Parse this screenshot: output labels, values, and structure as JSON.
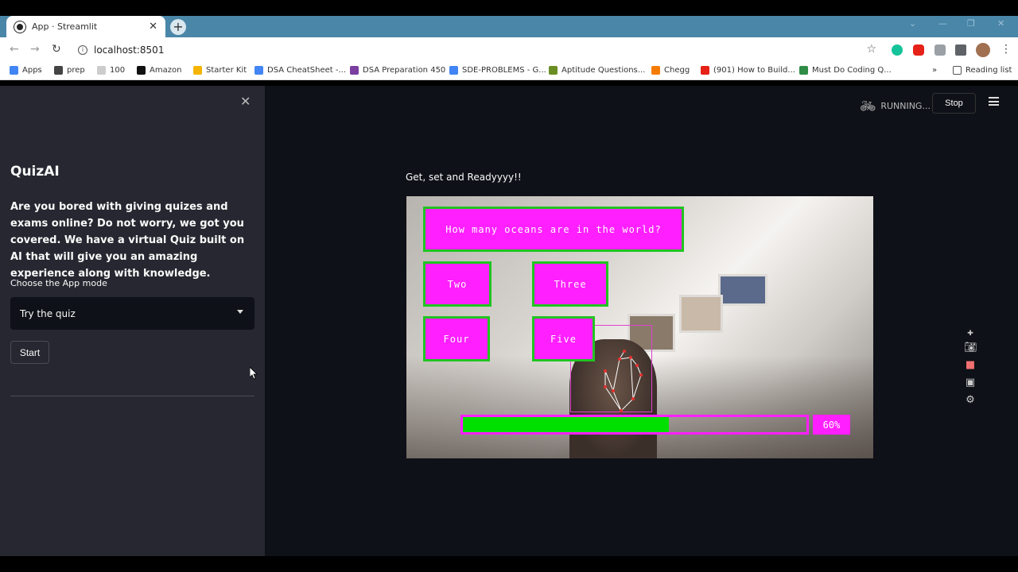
{
  "browser": {
    "tab_title": "App · Streamlit",
    "url": "localhost:8501",
    "bookmarks": [
      "Apps",
      "prep",
      "100",
      "Amazon",
      "Starter Kit",
      "DSA CheatSheet -...",
      "DSA Preparation 450",
      "SDE-PROBLEMS - G...",
      "Aptitude Questions...",
      "Chegg",
      "(901) How to Build...",
      "Must Do Coding Q..."
    ],
    "reading_list": "Reading list",
    "more": "»"
  },
  "sidebar": {
    "title": "QuizAI",
    "description": "Are you bored with giving quizes and exams online? Do not worry, we got you covered. We have a virtual Quiz built on AI that will give you an amazing experience along with knowledge.",
    "mode_label": "Choose the App mode",
    "mode_selected": "Try the quiz",
    "start_label": "Start"
  },
  "header": {
    "status": "RUNNING...",
    "stop_label": "Stop"
  },
  "main": {
    "caption": "Get, set and Readyyyy!!",
    "quiz": {
      "question": "How many oceans are in the world?",
      "options": [
        "Two",
        "Three",
        "Four",
        "Five"
      ],
      "progress_fraction": 0.6,
      "progress_label": "60%"
    }
  },
  "colors": {
    "quiz_box": "#ff1fff",
    "quiz_border": "#21c421",
    "progress": "#00e000",
    "sidebar_bg": "#262730",
    "main_bg": "#0e1117"
  }
}
